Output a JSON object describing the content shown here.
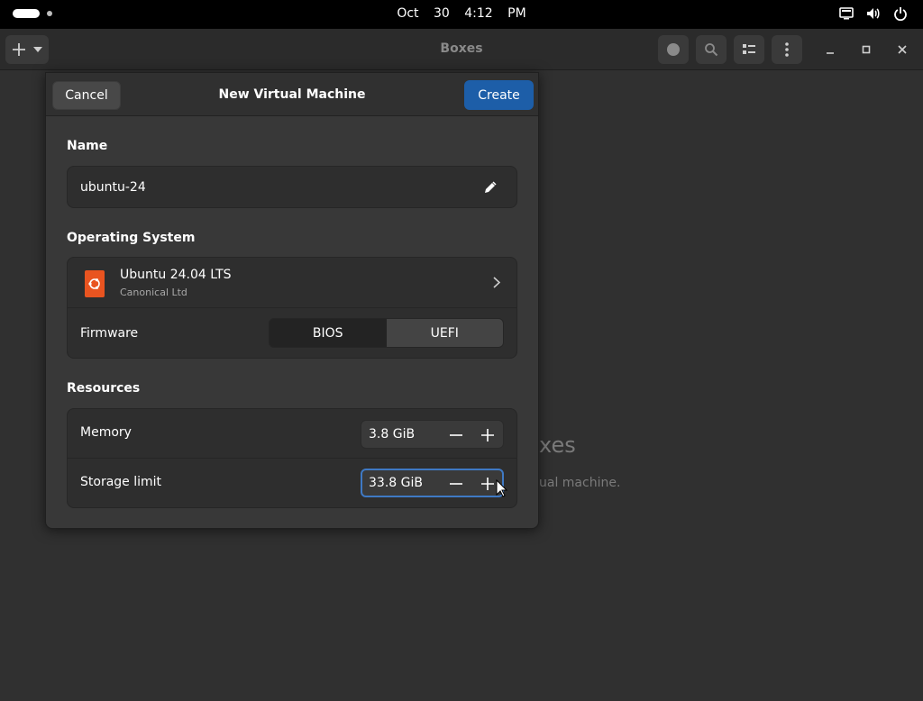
{
  "topbar": {
    "date": "Oct 30",
    "time": "4:12 PM",
    "tray_icons": [
      "screen-icon",
      "volume-icon",
      "power-icon"
    ]
  },
  "app": {
    "title": "Boxes",
    "header_buttons": [
      "new-vm-button",
      "record-button",
      "search-button",
      "view-toggle-button",
      "menu-button"
    ],
    "window_controls": [
      "minimize",
      "maximize",
      "close"
    ]
  },
  "background": {
    "title_fragment": "xes",
    "subtitle_fragment": "ual machine."
  },
  "dialog": {
    "title": "New Virtual Machine",
    "cancel_label": "Cancel",
    "create_label": "Create",
    "name_section": "Name",
    "name_value": "ubuntu-24",
    "os_section": "Operating System",
    "os_name": "Ubuntu 24.04 LTS",
    "os_vendor": "Canonical Ltd",
    "firmware_label": "Firmware",
    "firmware_options": [
      "BIOS",
      "UEFI"
    ],
    "firmware_selected": "BIOS",
    "resources_section": "Resources",
    "memory_label": "Memory",
    "memory_value": "3.8 GiB",
    "storage_label": "Storage limit",
    "storage_value": "33.8 GiB"
  },
  "colors": {
    "accent": "#1d5ea8",
    "focus_ring": "#3f79c4",
    "ubuntu_orange": "#e95420"
  }
}
